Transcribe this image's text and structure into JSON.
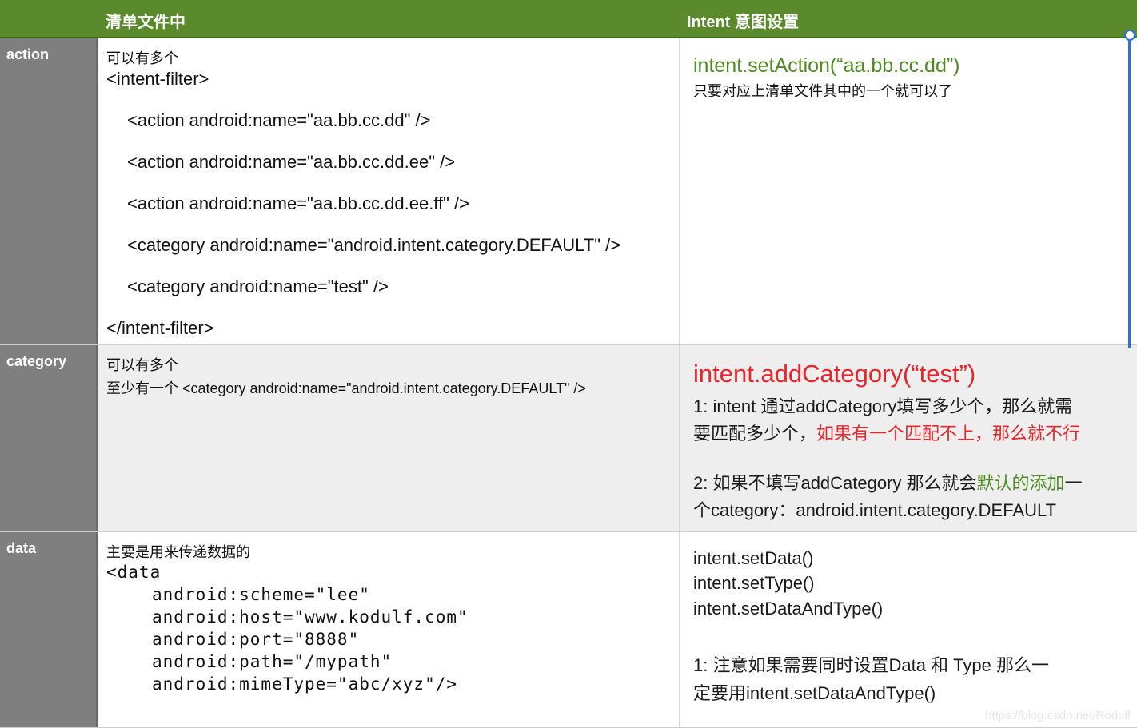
{
  "header": {
    "col1": "清单文件中",
    "col2": "Intent 意图设置"
  },
  "rows": [
    {
      "label": "action",
      "manifest": {
        "note": "可以有多个",
        "lines": [
          "<intent-filter>",
          "<action android:name=\"aa.bb.cc.dd\" />",
          "<action android:name=\"aa.bb.cc.dd.ee\" />",
          "<action android:name=\"aa.bb.cc.dd.ee.ff\" />",
          "<category android:name=\"android.intent.category.DEFAULT\" />",
          "<category android:name=\"test\" />",
          "</intent-filter>"
        ]
      },
      "intent": {
        "code": "intent.setAction(“aa.bb.cc.dd”)",
        "desc": "只要对应上清单文件其中的一个就可以了"
      }
    },
    {
      "label": "category",
      "manifest": {
        "note": "可以有多个",
        "line": "至少有一个 <category android:name=\"android.intent.category.DEFAULT\" />"
      },
      "intent": {
        "code": "intent.addCategory(“test”)",
        "p1_line1": "1: intent 通过addCategory填写多少个，那么就需",
        "p1_line2_a": "要匹配多少个，",
        "p1_line2_b": "如果有一个匹配不上，那么就不行",
        "p2_line1_a": "2: 如果不填写addCategory 那么就会",
        "p2_line1_b": "默认的添加",
        "p2_line1_c": "一",
        "p2_line2": "个category：android.intent.category.DEFAULT"
      }
    },
    {
      "label": "data",
      "manifest": {
        "note": "主要是用来传递数据的",
        "lines": [
          "<data",
          "android:scheme=\"lee\"",
          "android:host=\"www.kodulf.com\"",
          "android:port=\"8888\"",
          "android:path=\"/mypath\"",
          "android:mimeType=\"abc/xyz\"/>"
        ]
      },
      "intent": {
        "methods": [
          "intent.setData()",
          "intent.setType()",
          "intent.setDataAndType()"
        ],
        "note_line1": "1: 注意如果需要同时设置Data 和 Type 那么一",
        "note_line2": "定要用intent.setDataAndType()"
      }
    }
  ],
  "watermark": "https://blog.csdn.net/Rodulf",
  "colors": {
    "header_bg": "#5b8a2c",
    "label_bg": "#7f7f7f",
    "green_text": "#4e8a22",
    "red_text": "#e8262a",
    "selection_blue": "#2a72d8"
  }
}
